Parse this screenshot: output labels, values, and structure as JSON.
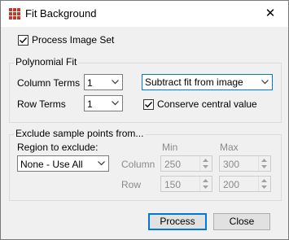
{
  "window": {
    "title": "Fit Background",
    "close_glyph": "✕"
  },
  "process_image_set": {
    "label": "Process Image Set",
    "checked": true
  },
  "polynomial_fit": {
    "group_title": "Polynomial Fit",
    "column_terms_label": "Column Terms",
    "column_terms_value": "1",
    "row_terms_label": "Row Terms",
    "row_terms_value": "1",
    "fit_mode_value": "Subtract fit from image",
    "conserve_label": "Conserve central value",
    "conserve_checked": true
  },
  "exclude": {
    "group_title": "Exclude sample points from...",
    "region_label": "Region to exclude:",
    "region_value": "None - Use All",
    "min_label": "Min",
    "max_label": "Max",
    "column_label": "Column",
    "row_label": "Row",
    "column_min": "250",
    "column_max": "300",
    "row_min": "150",
    "row_max": "200"
  },
  "buttons": {
    "process": "Process",
    "close": "Close"
  },
  "colors": {
    "accent": "#0078d7",
    "app_icon": "#c0392b",
    "disabled_text": "#8a8a8a"
  }
}
